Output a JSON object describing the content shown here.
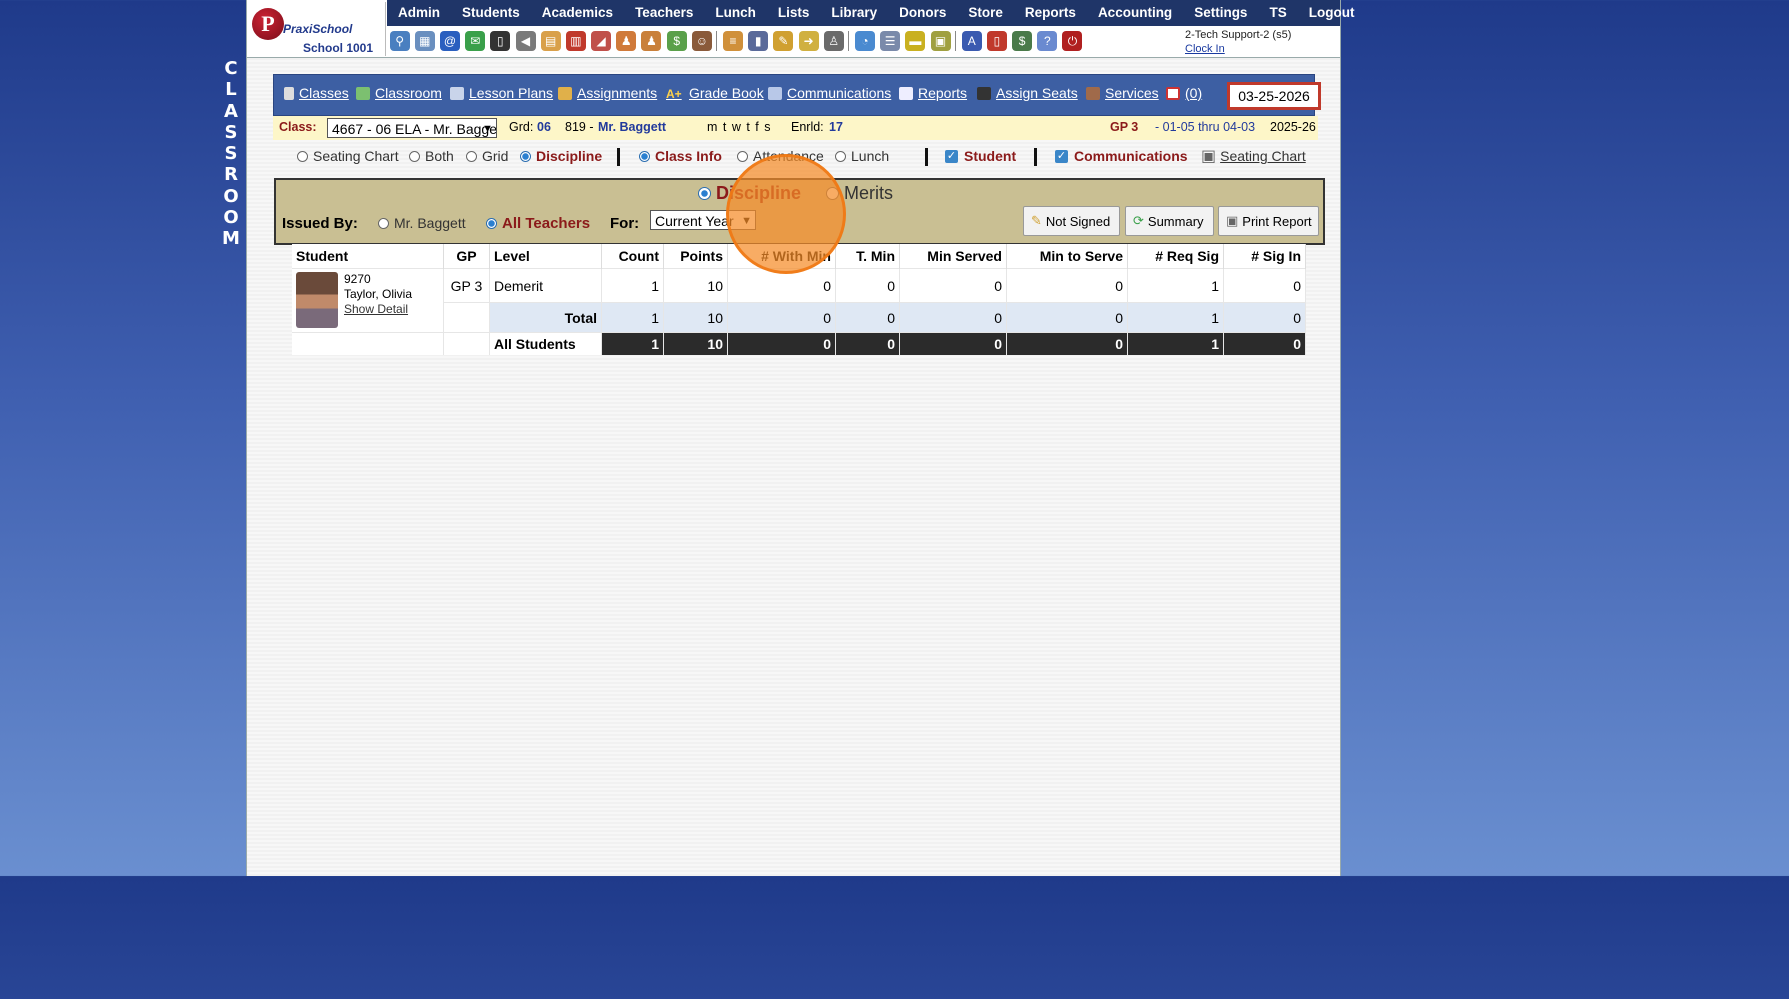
{
  "side_label": [
    "C",
    "L",
    "A",
    "S",
    "S",
    "R",
    "O",
    "O",
    "M"
  ],
  "logo": {
    "initial": "P",
    "name": "PraxiSchool",
    "school": "School 1001"
  },
  "menu": [
    "Admin",
    "Students",
    "Academics",
    "Teachers",
    "Lunch",
    "Lists",
    "Library",
    "Donors",
    "Store",
    "Reports",
    "Accounting",
    "Settings",
    "TS",
    "Logout"
  ],
  "toolbar_icons": [
    {
      "name": "search-icon",
      "color": "#4a7fc0",
      "glyph": "⚲"
    },
    {
      "name": "grid-icon",
      "color": "#6a8fbf",
      "glyph": "▦"
    },
    {
      "name": "email-icon",
      "color": "#2a5fbf",
      "glyph": "@"
    },
    {
      "name": "chat-icon",
      "color": "#3aa04a",
      "glyph": "✉"
    },
    {
      "name": "phone-icon",
      "color": "#333333",
      "glyph": "▯"
    },
    {
      "name": "speaker-icon",
      "color": "#7a7a7a",
      "glyph": "◀"
    },
    {
      "name": "calendar-icon",
      "color": "#d9a04a",
      "glyph": "▤"
    },
    {
      "name": "calendar-date-icon",
      "color": "#c0392b",
      "glyph": "▥"
    },
    {
      "name": "megaphone-icon",
      "color": "#c0504a",
      "glyph": "◢"
    },
    {
      "name": "student-icon",
      "color": "#d07a3a",
      "glyph": "♟"
    },
    {
      "name": "teacher-icon",
      "color": "#c9803a",
      "glyph": "♟"
    },
    {
      "name": "money-icon",
      "color": "#5aa04a",
      "glyph": "$"
    },
    {
      "name": "people-icon",
      "color": "#8a5a3a",
      "glyph": "☺"
    },
    {
      "name": "lunch-icon",
      "color": "#d0903a",
      "glyph": "≡"
    },
    {
      "name": "book-icon",
      "color": "#5a6a9a",
      "glyph": "▮"
    },
    {
      "name": "pencil-icon",
      "color": "#d0a030",
      "glyph": "✎"
    },
    {
      "name": "export-icon",
      "color": "#d0b040",
      "glyph": "➜"
    },
    {
      "name": "user-icon",
      "color": "#6a6a6a",
      "glyph": "♙"
    },
    {
      "name": "clock-icon",
      "color": "#4a8ad0",
      "glyph": "◔"
    },
    {
      "name": "list-icon",
      "color": "#7a8aaa",
      "glyph": "☰"
    },
    {
      "name": "card-icon",
      "color": "#c9b020",
      "glyph": "▬"
    },
    {
      "name": "printer-icon",
      "color": "#a0a040",
      "glyph": "▣"
    },
    {
      "name": "ap-icon",
      "color": "#3a5ab0",
      "glyph": "A"
    },
    {
      "name": "pdf-icon",
      "color": "#c0392b",
      "glyph": "▯"
    },
    {
      "name": "cash-icon",
      "color": "#4a7a4a",
      "glyph": "$"
    },
    {
      "name": "help-icon",
      "color": "#6a8ad0",
      "glyph": "?"
    },
    {
      "name": "power-icon",
      "color": "#b02020",
      "glyph": "⏻"
    }
  ],
  "user": {
    "name": "2-Tech Support-2 (s5)",
    "clock": "Clock In"
  },
  "nav": {
    "items": [
      "Classes",
      "Classroom",
      "Lesson Plans",
      "Assignments",
      "Grade Book",
      "Communications",
      "Reports",
      "Assign Seats",
      "Services",
      "(0)"
    ],
    "date": "03-25-2026"
  },
  "class_info": {
    "class_label": "Class:",
    "class_value": "4667 - 06 ELA - Mr. Baggett",
    "grd_label": "Grd:",
    "grd_value": "06",
    "room": "819 -",
    "teacher": "Mr. Baggett",
    "days": "m t w t f s",
    "enrld_label": "Enrld:",
    "enrld_value": "17",
    "gp": "GP 3",
    "gp_range": "- 01-05 thru 04-03",
    "year": "2025-26"
  },
  "view_options": {
    "radios": [
      "Seating Chart",
      "Both",
      "Grid",
      "Discipline"
    ],
    "selected": "Discipline",
    "info_radios": [
      "Class Info",
      "Attendance",
      "Lunch"
    ],
    "info_selected": "Class Info",
    "checks": [
      "Student",
      "Communications"
    ],
    "print_link": "Seating Chart"
  },
  "panel": {
    "mode_options": [
      "Discipline",
      "Merits"
    ],
    "mode_selected": "Discipline",
    "issued_label": "Issued By:",
    "issued_options": [
      "Mr. Baggett",
      "All Teachers"
    ],
    "issued_selected": "All Teachers",
    "for_label": "For:",
    "for_value": "Current Year",
    "buttons": [
      "Not Signed",
      "Summary",
      "Print Report"
    ]
  },
  "table": {
    "headers": [
      "Student",
      "GP",
      "Level",
      "Count",
      "Points",
      "# With Min",
      "T. Min",
      "Min Served",
      "Min to Serve",
      "# Req Sig",
      "# Sig In"
    ],
    "student": {
      "id": "9270",
      "name": "Taylor, Olivia",
      "detail": "Show Detail"
    },
    "row": [
      "GP 3",
      "Demerit",
      "1",
      "10",
      "0",
      "0",
      "0",
      "0",
      "1",
      "0"
    ],
    "total_label": "Total",
    "total": [
      "1",
      "10",
      "0",
      "0",
      "0",
      "0",
      "1",
      "0"
    ],
    "all_label": "All Students",
    "all": [
      "1",
      "10",
      "0",
      "0",
      "0",
      "0",
      "1",
      "0"
    ]
  }
}
